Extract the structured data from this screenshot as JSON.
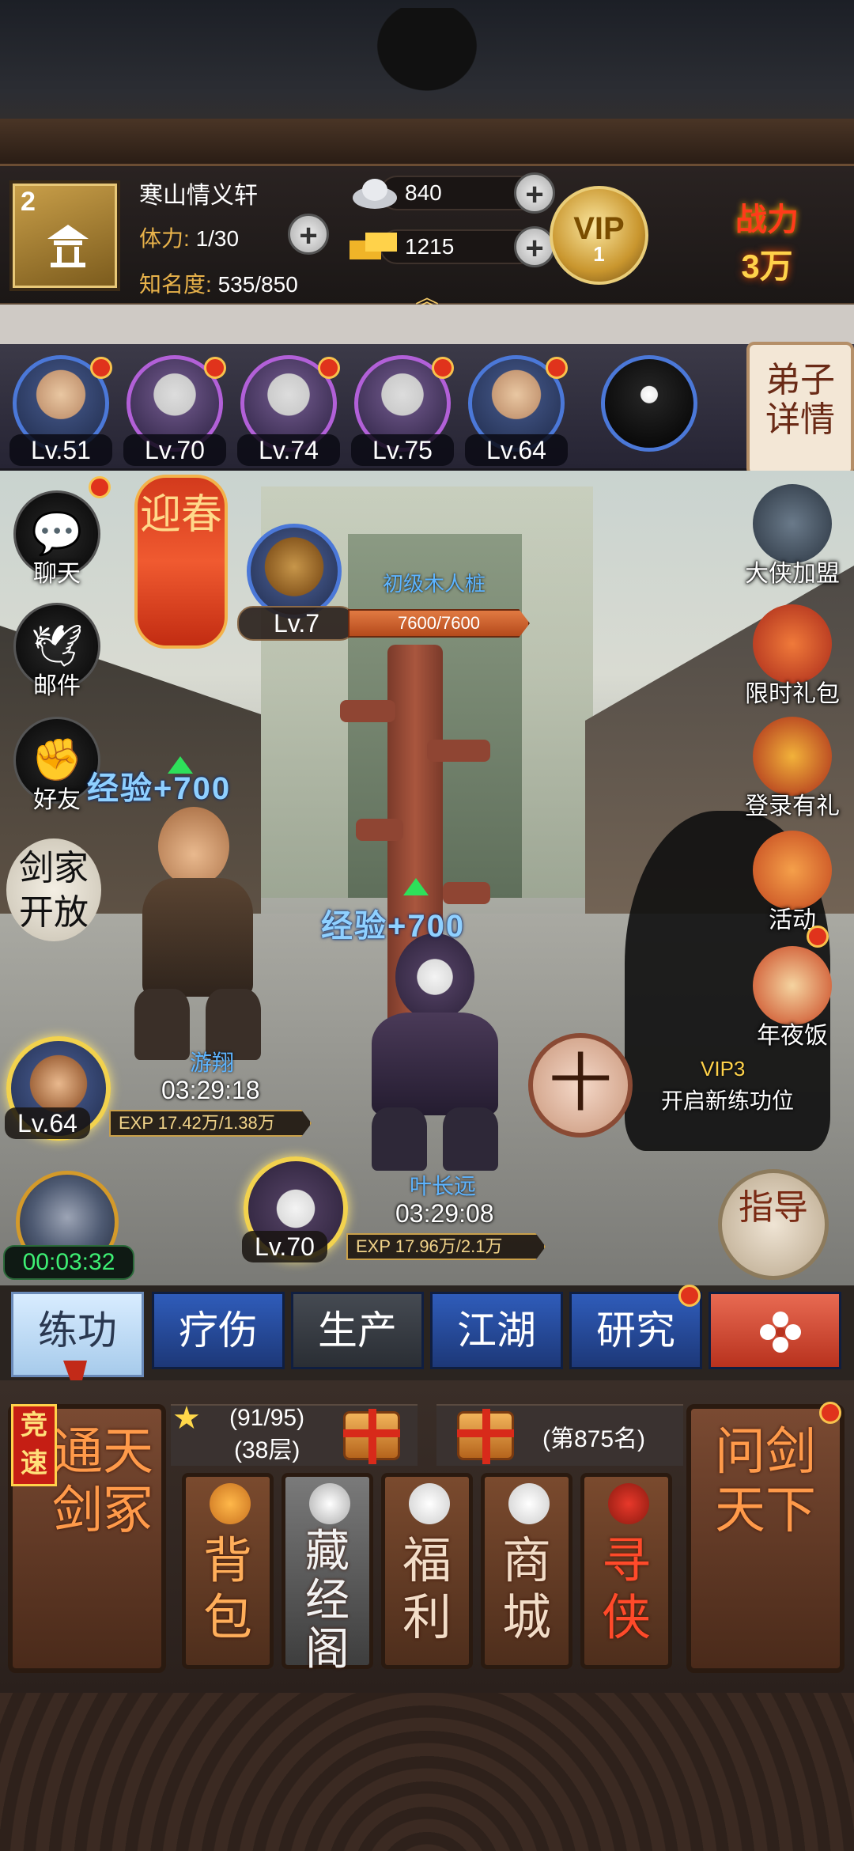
{
  "player": {
    "level_badge": "2",
    "name": "寒山情义轩",
    "stamina_label": "体力:",
    "stamina_value": "1/30",
    "fame_label": "知名度:",
    "fame_value": "535/850"
  },
  "currency": {
    "silver": "840",
    "gold": "1215",
    "plus": "+"
  },
  "vip": {
    "label": "VIP",
    "level": "1"
  },
  "power": {
    "label": "战力",
    "value": "3万"
  },
  "disciples": [
    {
      "level": "Lv.51",
      "dot": true,
      "ring": "blue"
    },
    {
      "level": "Lv.70",
      "dot": true,
      "ring": "purple"
    },
    {
      "level": "Lv.74",
      "dot": true,
      "ring": "purple"
    },
    {
      "level": "Lv.75",
      "dot": true,
      "ring": "purple"
    },
    {
      "level": "Lv.64",
      "dot": true,
      "ring": "blue"
    },
    {
      "level": "",
      "dot": false,
      "ring": "blue"
    }
  ],
  "disciple_detail_label": "弟子详情",
  "side_left": {
    "chat": "聊天",
    "mail": "邮件",
    "friends": "好友",
    "jjfz": "剑家开放"
  },
  "lantern": "迎春",
  "target": {
    "name": "初级木人桩",
    "level": "Lv.7",
    "hp": "7600/7600"
  },
  "exp_gain": "经验+700",
  "right_menu": {
    "alliance": "大侠加盟",
    "limited_gift": "限时礼包",
    "login_gift": "登录有礼",
    "activity": "活动",
    "new_year": "年夜饭"
  },
  "trainees": [
    {
      "name": "游翔",
      "time": "03:29:18",
      "level": "Lv.64",
      "exp": "EXP 17.42万/1.38万"
    },
    {
      "name": "叶长远",
      "time": "03:29:08",
      "level": "Lv.70",
      "exp": "EXP 17.96万/2.1万"
    }
  ],
  "new_slot": {
    "vip": "VIP3",
    "text": "开启新练功位",
    "plus": "十"
  },
  "samurai_timer": "00:03:32",
  "guide_label": "指导",
  "tabs": [
    "练功",
    "疗伤",
    "生产",
    "江湖",
    "研究"
  ],
  "bottom": {
    "left_card": "通天剑冢",
    "jingsu": "竞速",
    "progress": "(91/95)",
    "floor": "(38层)",
    "rank": "(第875名)",
    "right_card": "问剑天下",
    "cards": [
      "背包",
      "藏经阁",
      "福利",
      "商城",
      "寻侠"
    ]
  },
  "colors": {
    "accent_gold": "#e8b24a",
    "exp_blue": "#8fd0ff",
    "tab_blue": "#2f5cba",
    "timer_green": "#3ef074"
  }
}
